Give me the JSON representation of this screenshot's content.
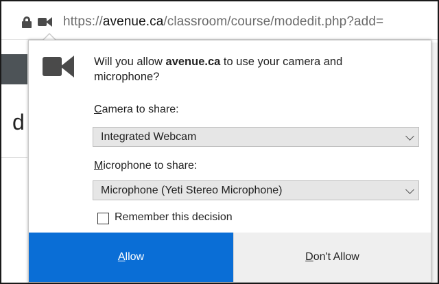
{
  "url_bar": {
    "scheme": "https://",
    "host": "avenue.ca",
    "path": "/classroom/course/modedit.php?add="
  },
  "background": {
    "partial_heading": "d"
  },
  "permission_prompt": {
    "question_prefix": "Will you allow ",
    "question_host": "avenue.ca",
    "question_suffix": " to use your camera and microphone?",
    "camera_label_accesskey": "C",
    "camera_label_rest": "amera to share:",
    "camera_selected": "Integrated Webcam",
    "microphone_label_accesskey": "M",
    "microphone_label_rest": "icrophone to share:",
    "microphone_selected": "Microphone (Yeti Stereo Microphone)",
    "remember_label": "Remember this decision",
    "remember_checked": false,
    "allow_accesskey": "A",
    "allow_rest": "llow",
    "deny_accesskey": "D",
    "deny_rest": "on't Allow",
    "allow_color": "#0a6ed6"
  },
  "icons": {
    "lock": "lock-icon",
    "camera_small": "camera-icon",
    "camera_large": "camera-icon"
  }
}
